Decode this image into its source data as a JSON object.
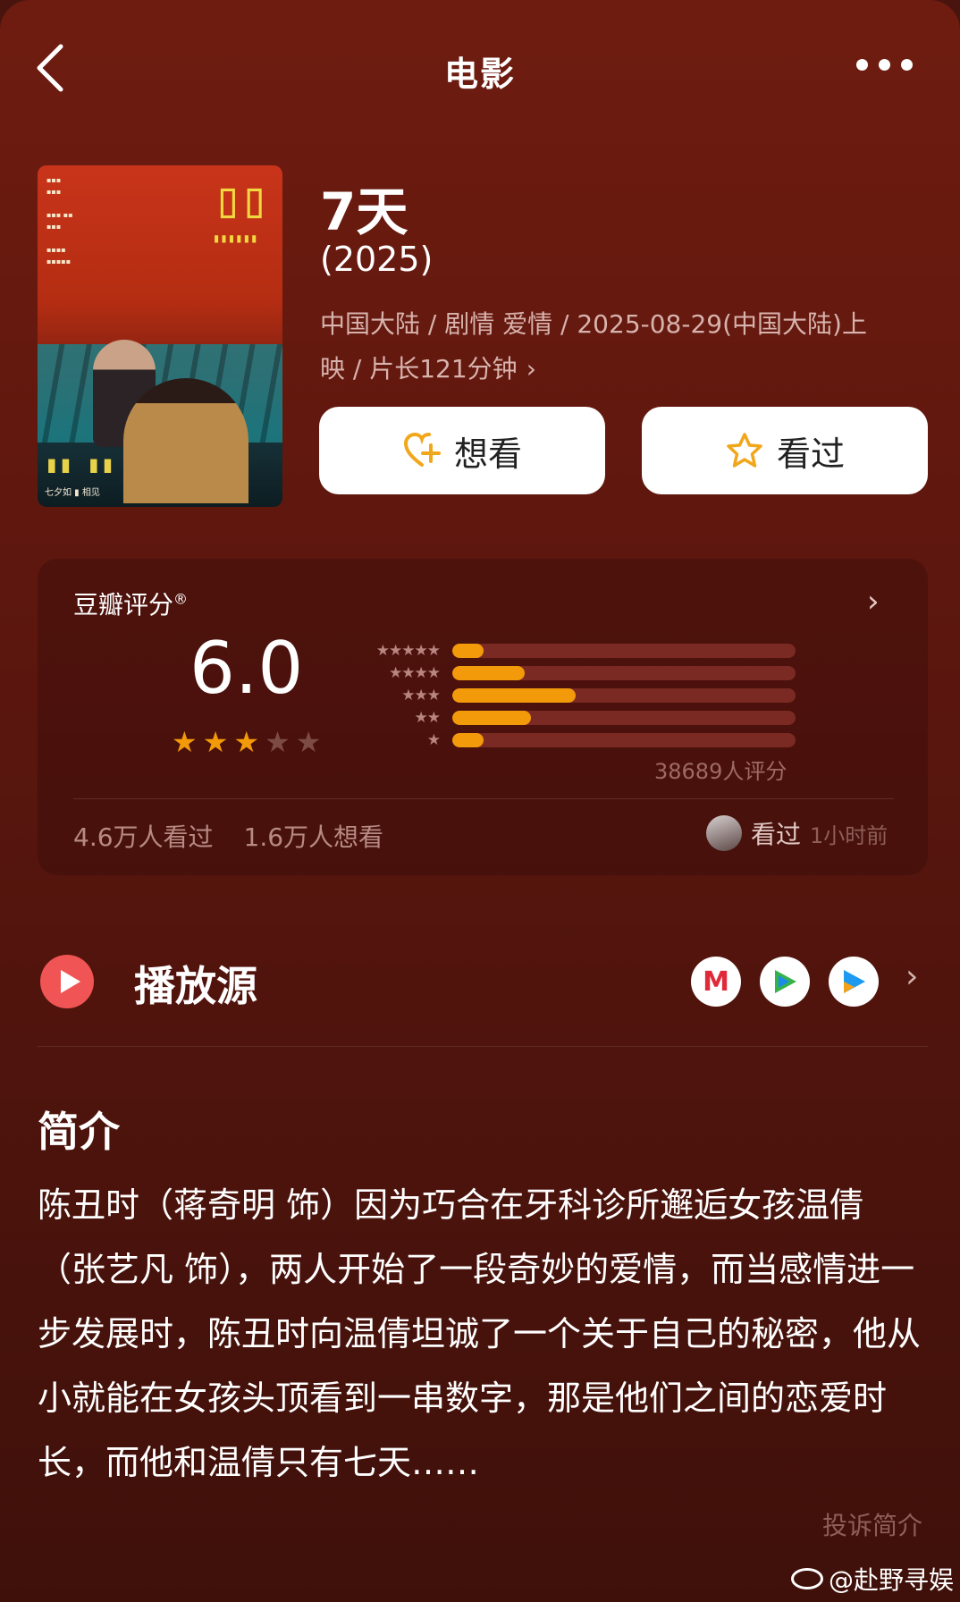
{
  "header": {
    "title": "电影"
  },
  "movie": {
    "title": "7天",
    "year": "(2025)",
    "meta_line1": "中国大陆 / 剧情 爱情 / 2025-08-29(中国大陆)上",
    "meta_line2": "映 / 片长121分钟",
    "poster_tagline": "七夕如",
    "poster_tagline2": "相见"
  },
  "actions": {
    "want_label": "想看",
    "seen_label": "看过"
  },
  "rating": {
    "heading": "豆瓣评分",
    "reg_mark": "®",
    "score": "6.0",
    "stars": 3,
    "star_rows": [
      "★★★★★",
      "★★★★",
      "★★★",
      "★★",
      "★"
    ],
    "distribution": [
      0.09,
      0.21,
      0.36,
      0.23,
      0.09
    ],
    "count_text": "38689人评分",
    "seen_count": "4.6万人看过",
    "want_count": "1.6万人想看",
    "recent_action": "看过",
    "recent_time": "1小时前"
  },
  "colors": {
    "accent": "#f39a0b",
    "play": "#f05454",
    "background": "#5e170e"
  },
  "source": {
    "label": "播放源",
    "apps": [
      "mango-tv-icon",
      "tencent-video-icon",
      "youku-icon"
    ]
  },
  "intro": {
    "heading": "简介",
    "text": "陈丑时（蒋奇明 饰）因为巧合在牙科诊所邂逅女孩温倩（张艺凡 饰），两人开始了一段奇妙的爱情，而当感情进一步发展时，陈丑时向温倩坦诚了一个关于自己的秘密，他从小就能在女孩头顶看到一串数字，那是他们之间的恋爱时长，而他和温倩只有七天……",
    "complain": "投诉简介"
  },
  "watermark": "@赴野寻娱"
}
